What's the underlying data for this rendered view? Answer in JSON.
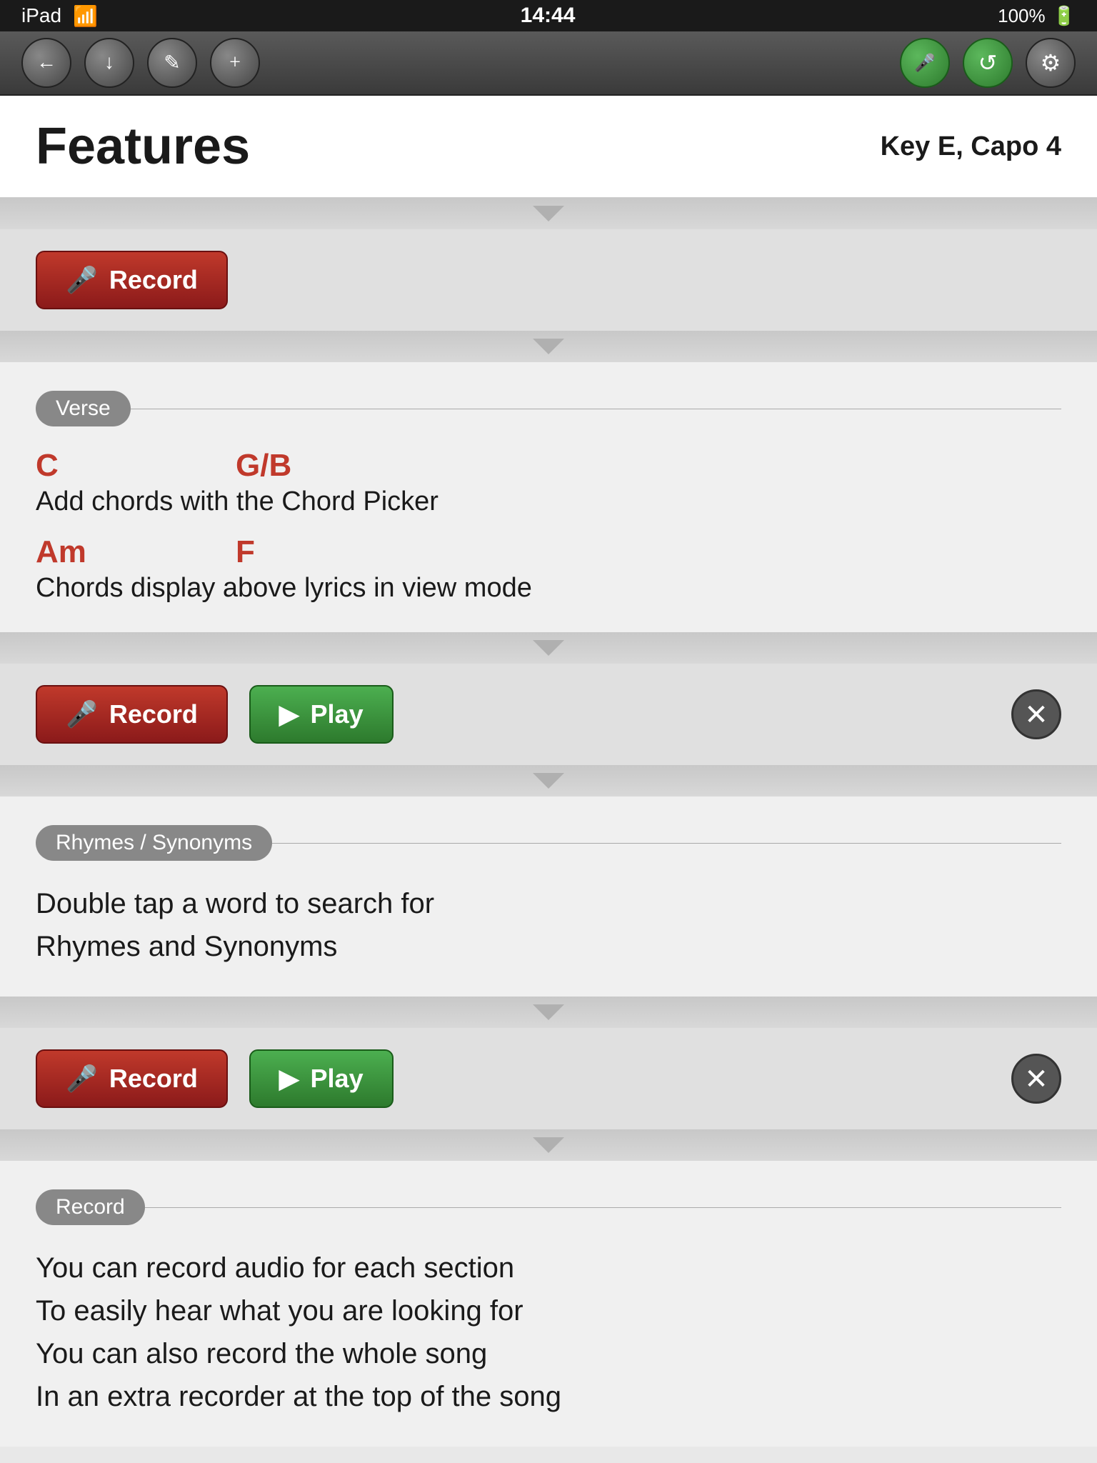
{
  "statusBar": {
    "device": "iPad",
    "wifi": "wifi",
    "time": "14:44",
    "battery": "100%"
  },
  "toolbar": {
    "navButtons": [
      {
        "name": "back-button",
        "icon": "←"
      },
      {
        "name": "download-button",
        "icon": "↓"
      },
      {
        "name": "edit-button",
        "icon": "✏"
      },
      {
        "name": "add-button",
        "icon": "+"
      }
    ],
    "actionButtons": [
      {
        "name": "microphone-button",
        "icon": "🎤",
        "color": "green"
      },
      {
        "name": "refresh-button",
        "icon": "↺",
        "color": "green"
      },
      {
        "name": "settings-button",
        "icon": "⚙",
        "color": "gray"
      }
    ]
  },
  "header": {
    "title": "Features",
    "keyCapo": "Key E, Capo 4"
  },
  "sections": [
    {
      "type": "record-only",
      "recordLabel": "Record"
    },
    {
      "type": "content",
      "label": "Verse",
      "chords": [
        {
          "chord1": "C",
          "chord1pos": 0,
          "chord2": "G/B",
          "chord2pos": 280
        },
        {
          "lyric": "Add chords with the Chord Picker"
        },
        {
          "chord1": "Am",
          "chord1pos": 0,
          "chord2": "F",
          "chord2pos": 280
        },
        {
          "lyric": "Chords display above lyrics in view mode"
        }
      ]
    },
    {
      "type": "record-play",
      "recordLabel": "Record",
      "playLabel": "Play",
      "hasClose": true
    },
    {
      "type": "content",
      "label": "Rhymes / Synonyms",
      "bodyText": "Double tap a word to search for\nRhymes and Synonyms"
    },
    {
      "type": "record-play",
      "recordLabel": "Record",
      "playLabel": "Play",
      "hasClose": true
    },
    {
      "type": "content",
      "label": "Record",
      "bodyText": "You can record audio for each section\nTo easily hear what you are looking for\nYou can also record the whole song\nIn an extra recorder at the top of the song"
    }
  ]
}
